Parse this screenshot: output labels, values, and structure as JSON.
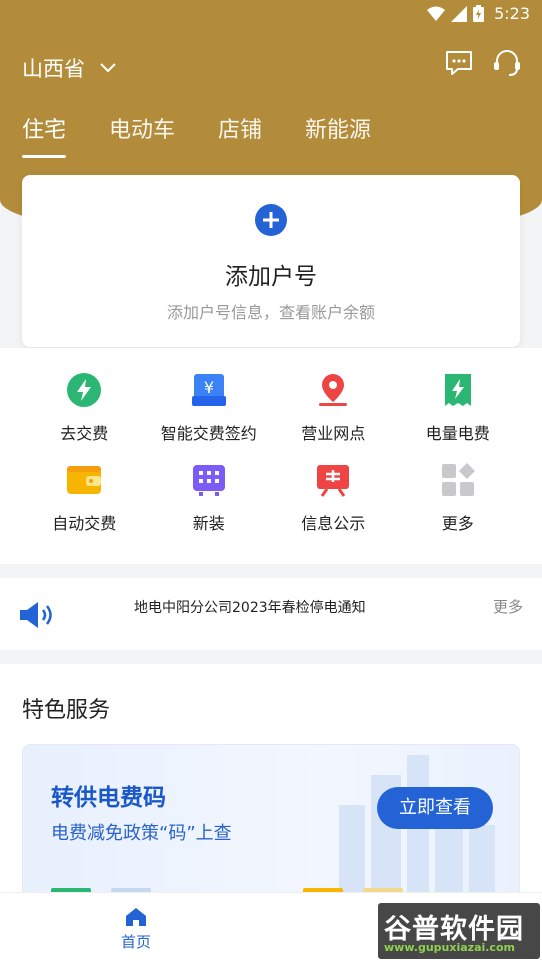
{
  "status_bar": {
    "time": "5:23"
  },
  "header": {
    "region": "山西省",
    "tabs": [
      {
        "label": "住宅",
        "active": true
      },
      {
        "label": "电动车",
        "active": false
      },
      {
        "label": "店铺",
        "active": false
      },
      {
        "label": "新能源",
        "active": false
      }
    ]
  },
  "add_account": {
    "title": "添加户号",
    "subtitle": "添加户号信息，查看账户余额"
  },
  "services": [
    {
      "label": "去交费",
      "icon": "lightning-circle-icon"
    },
    {
      "label": "智能交费签约",
      "icon": "yen-card-icon"
    },
    {
      "label": "营业网点",
      "icon": "location-pin-icon"
    },
    {
      "label": "电量电费",
      "icon": "bill-lightning-icon"
    },
    {
      "label": "自动交费",
      "icon": "wallet-icon"
    },
    {
      "label": "新装",
      "icon": "meter-icon"
    },
    {
      "label": "信息公示",
      "icon": "notice-board-icon"
    },
    {
      "label": "更多",
      "icon": "more-grid-icon"
    }
  ],
  "notice": {
    "text": "地电中阳分公司2023年春检停电通知",
    "more_label": "更多"
  },
  "special": {
    "title": "特色服务",
    "banner": {
      "title": "转供电费码",
      "subtitle": "电费减免政策“码”上查",
      "button": "立即查看"
    }
  },
  "bottom_nav": {
    "home_label": "首页"
  },
  "watermark": {
    "line1": "谷普软件园",
    "line2": "www.gupuxiazai.com"
  },
  "colors": {
    "header": "#b38c3b",
    "accent": "#2463d6"
  }
}
